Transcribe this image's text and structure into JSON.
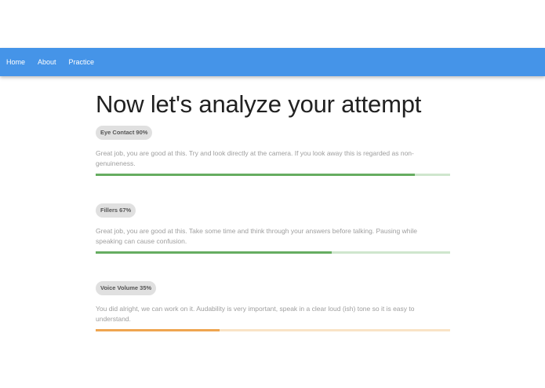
{
  "nav": {
    "links": [
      "Home",
      "About",
      "Practice"
    ],
    "color": "#4594e8"
  },
  "title": "Now let's analyze your attempt",
  "metrics": [
    {
      "label": "Eye Contact 90%",
      "description": "Great job, you are good at this. Try and look directly at the camera. If you look away this is regarded as non-genuineness.",
      "progress": 0.9,
      "color": "#66ad61",
      "track_color": "#cfe6cd"
    },
    {
      "label": "Fillers 67%",
      "description": "Great job, you are good at this. Take some time and think through your answers before talking. Pausing while speaking can cause confusion.",
      "progress": 0.667,
      "color": "#66ad61",
      "track_color": "#cfe6cd"
    },
    {
      "label": "Voice Volume 35%",
      "description": "You did alright, we can work on it. Audability is very important, speak in a clear loud (ish) tone so it is easy to understand.",
      "progress": 0.35,
      "color": "#efa550",
      "track_color": "#f9e3c6"
    }
  ]
}
